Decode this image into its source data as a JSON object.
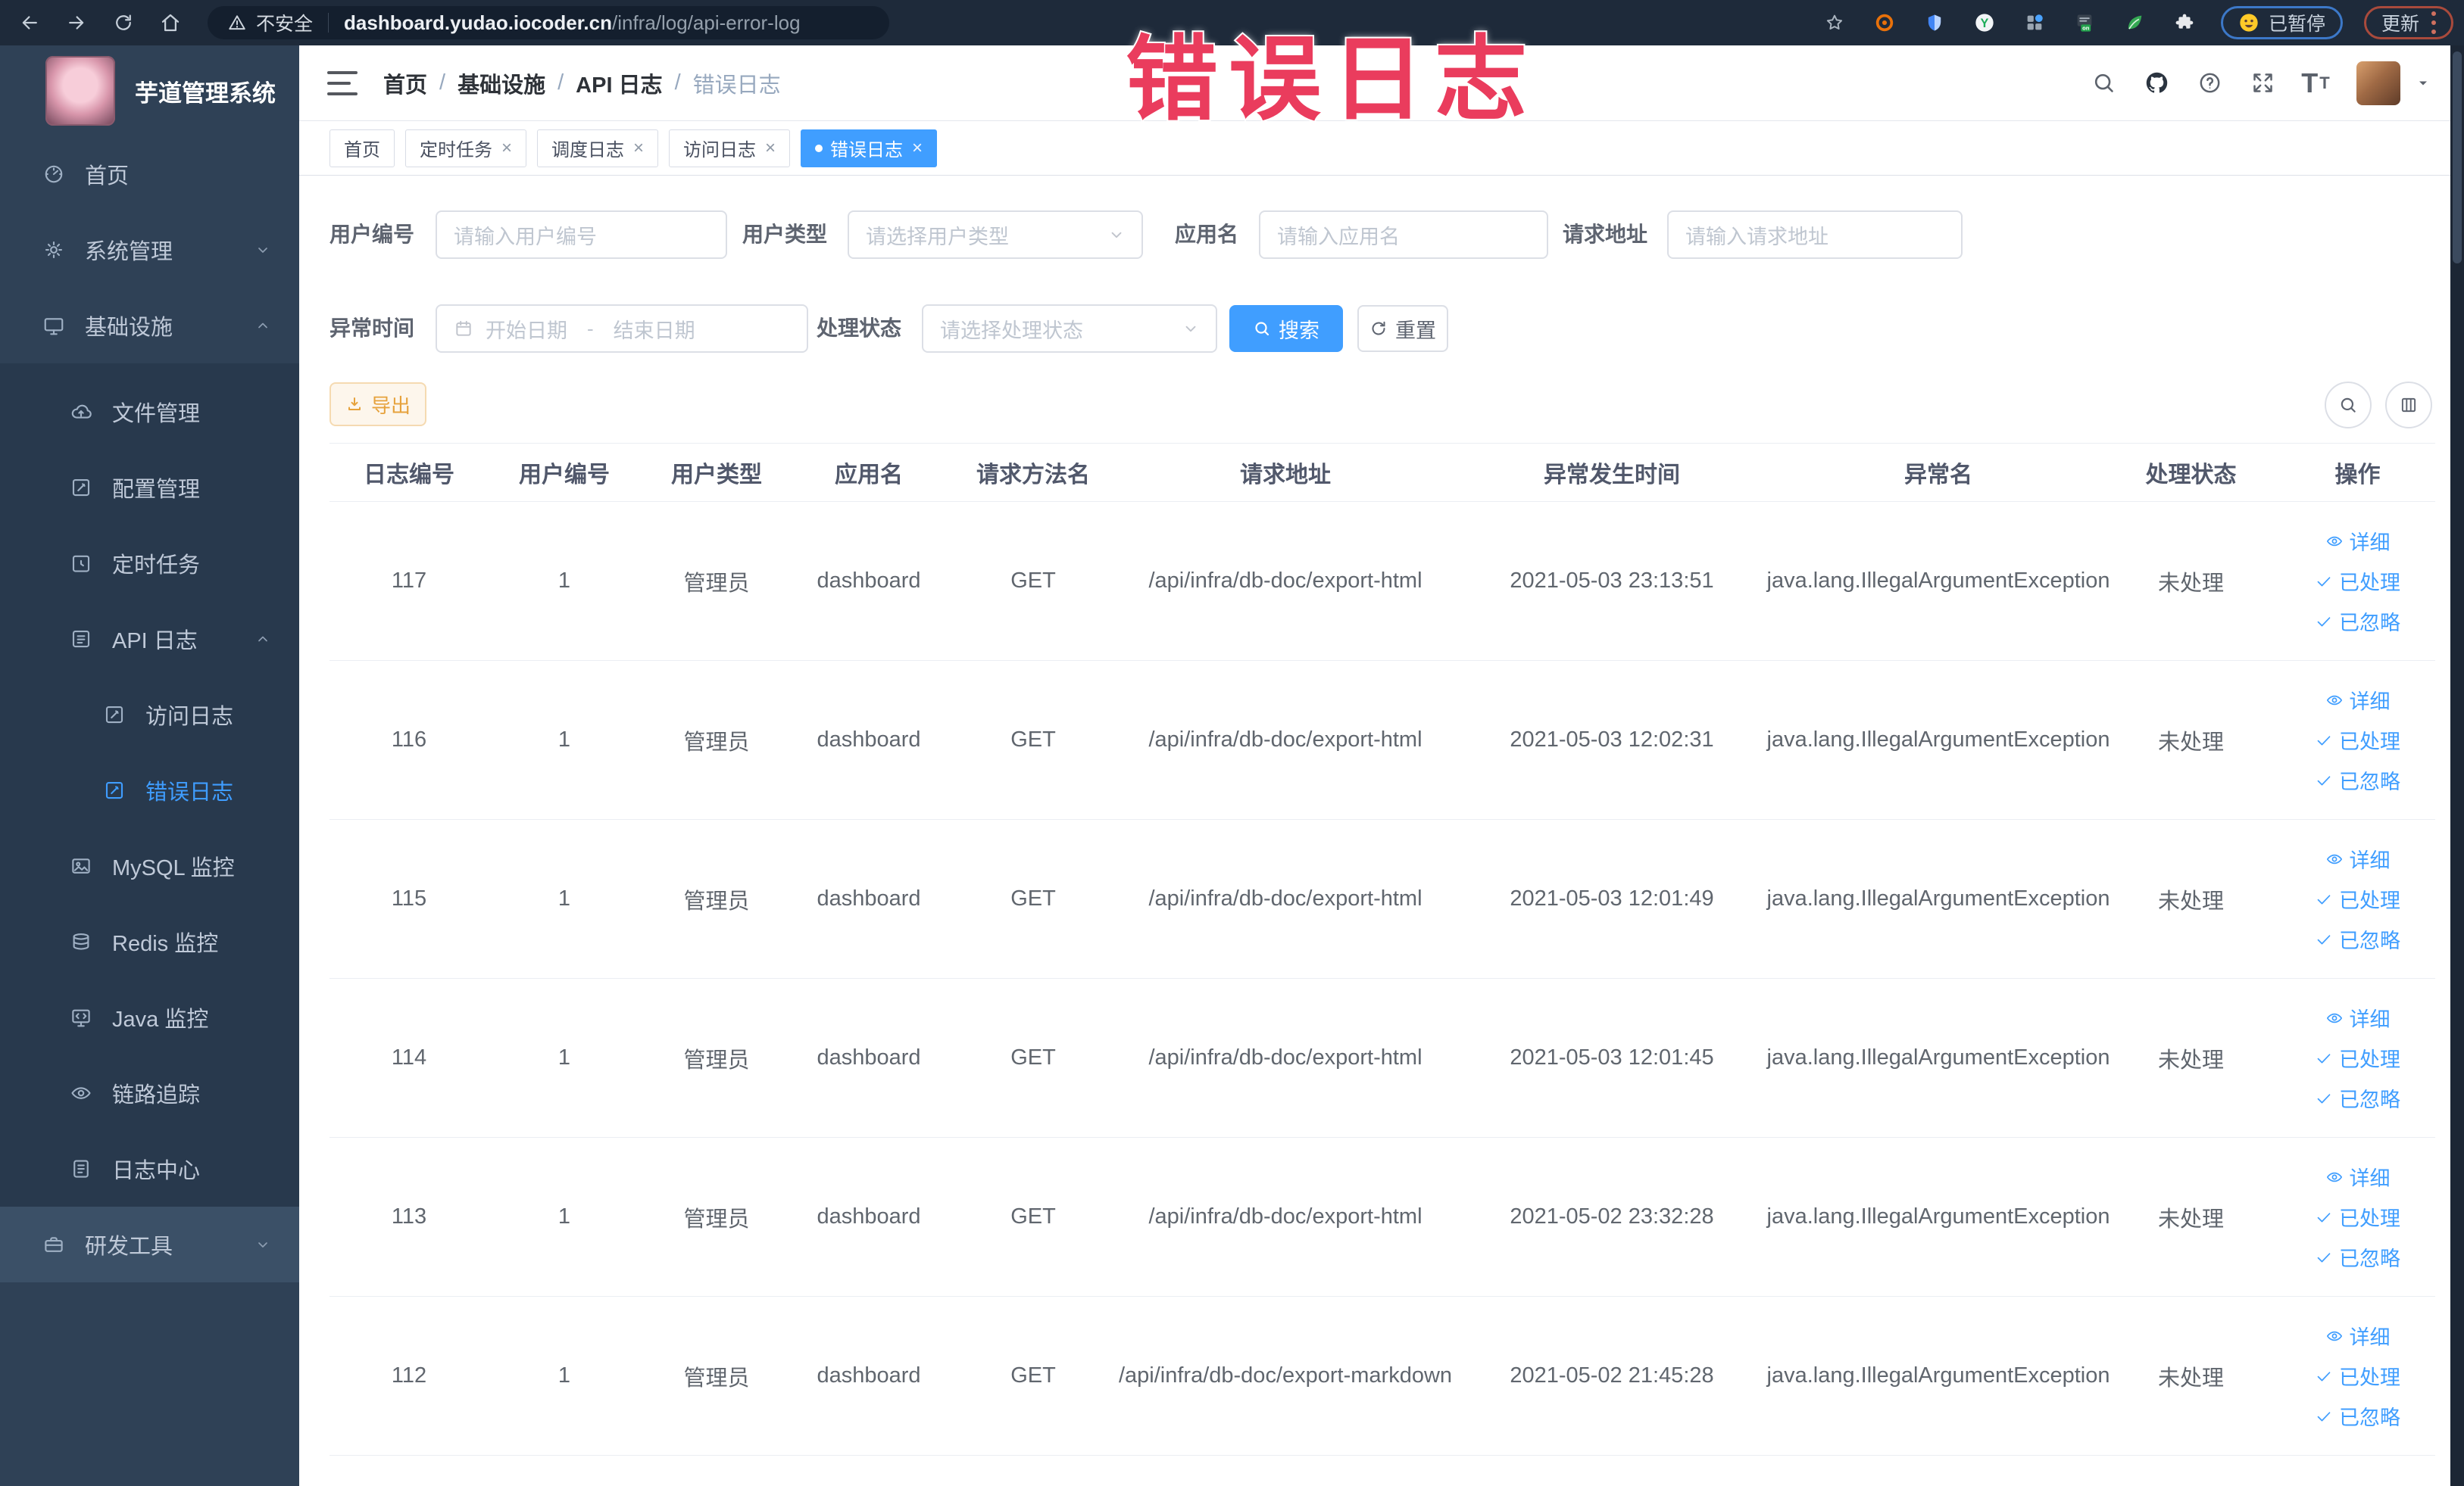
{
  "browser": {
    "security_label": "不安全",
    "url_host": "dashboard.yudao.iocoder.cn",
    "url_path": "/infra/log/api-error-log",
    "ext_badge": "on",
    "paused_label": "已暂停",
    "update_label": "更新"
  },
  "annotation": {
    "text": "错误日志",
    "color": "#ea3c5d"
  },
  "sidebar": {
    "title": "芋道管理系统",
    "items": [
      {
        "label": "首页",
        "icon": "home-icon",
        "level": 1
      },
      {
        "label": "系统管理",
        "icon": "gear-icon",
        "level": 1,
        "chevron": "down"
      },
      {
        "label": "基础设施",
        "icon": "infra-icon",
        "level": 1,
        "chevron": "up"
      },
      {
        "label": "文件管理",
        "icon": "file-icon",
        "level": 2,
        "group": true,
        "pad": true
      },
      {
        "label": "配置管理",
        "icon": "config-icon",
        "level": 2,
        "group": true
      },
      {
        "label": "定时任务",
        "icon": "timer-icon",
        "level": 2,
        "group": true
      },
      {
        "label": "API 日志",
        "icon": "api-log-icon",
        "level": 2,
        "group": true,
        "chevron": "up"
      },
      {
        "label": "访问日志",
        "icon": "doc-icon",
        "level": 3,
        "group": true
      },
      {
        "label": "错误日志",
        "icon": "doc-icon",
        "level": 3,
        "group": true,
        "active": true
      },
      {
        "label": "MySQL 监控",
        "icon": "mysql-icon",
        "level": 2,
        "group": true
      },
      {
        "label": "Redis 监控",
        "icon": "redis-icon",
        "level": 2,
        "group": true
      },
      {
        "label": "Java 监控",
        "icon": "java-icon",
        "level": 2,
        "group": true
      },
      {
        "label": "链路追踪",
        "icon": "trace-icon",
        "level": 2,
        "group": true
      },
      {
        "label": "日志中心",
        "icon": "log-center-icon",
        "level": 2,
        "group": true
      },
      {
        "label": "研发工具",
        "icon": "devtools-icon",
        "level": 1,
        "chevron": "down",
        "highlight": true
      }
    ]
  },
  "breadcrumb": [
    "首页",
    "基础设施",
    "API 日志",
    "错误日志"
  ],
  "tabs": [
    {
      "label": "首页"
    },
    {
      "label": "定时任务",
      "closable": true
    },
    {
      "label": "调度日志",
      "closable": true
    },
    {
      "label": "访问日志",
      "closable": true
    },
    {
      "label": "错误日志",
      "closable": true,
      "active": true
    }
  ],
  "filters": {
    "user_id": {
      "label": "用户编号",
      "placeholder": "请输入用户编号"
    },
    "user_type": {
      "label": "用户类型",
      "placeholder": "请选择用户类型"
    },
    "app_name": {
      "label": "应用名",
      "placeholder": "请输入应用名"
    },
    "request_url": {
      "label": "请求地址",
      "placeholder": "请输入请求地址"
    },
    "exception_time": {
      "label": "异常时间",
      "start_placeholder": "开始日期",
      "separator": "-",
      "end_placeholder": "结束日期"
    },
    "process_status": {
      "label": "处理状态",
      "placeholder": "请选择处理状态"
    },
    "search_label": "搜索",
    "reset_label": "重置"
  },
  "toolbar": {
    "export_label": "导出"
  },
  "table": {
    "columns": [
      "日志编号",
      "用户编号",
      "用户类型",
      "应用名",
      "请求方法名",
      "请求地址",
      "异常发生时间",
      "异常名",
      "处理状态",
      "操作"
    ],
    "action_labels": [
      "详细",
      "已处理",
      "已忽略"
    ],
    "rows": [
      {
        "log_id": "117",
        "user_id": "1",
        "user_type": "管理员",
        "app_name": "dashboard",
        "method": "GET",
        "url": "/api/infra/db-doc/export-html",
        "time": "2021-05-03 23:13:51",
        "exception": "java.lang.IllegalArgumentException",
        "status": "未处理"
      },
      {
        "log_id": "116",
        "user_id": "1",
        "user_type": "管理员",
        "app_name": "dashboard",
        "method": "GET",
        "url": "/api/infra/db-doc/export-html",
        "time": "2021-05-03 12:02:31",
        "exception": "java.lang.IllegalArgumentException",
        "status": "未处理"
      },
      {
        "log_id": "115",
        "user_id": "1",
        "user_type": "管理员",
        "app_name": "dashboard",
        "method": "GET",
        "url": "/api/infra/db-doc/export-html",
        "time": "2021-05-03 12:01:49",
        "exception": "java.lang.IllegalArgumentException",
        "status": "未处理"
      },
      {
        "log_id": "114",
        "user_id": "1",
        "user_type": "管理员",
        "app_name": "dashboard",
        "method": "GET",
        "url": "/api/infra/db-doc/export-html",
        "time": "2021-05-03 12:01:45",
        "exception": "java.lang.IllegalArgumentException",
        "status": "未处理"
      },
      {
        "log_id": "113",
        "user_id": "1",
        "user_type": "管理员",
        "app_name": "dashboard",
        "method": "GET",
        "url": "/api/infra/db-doc/export-html",
        "time": "2021-05-02 23:32:28",
        "exception": "java.lang.IllegalArgumentException",
        "status": "未处理"
      },
      {
        "log_id": "112",
        "user_id": "1",
        "user_type": "管理员",
        "app_name": "dashboard",
        "method": "GET",
        "url": "/api/infra/db-doc/export-markdown",
        "time": "2021-05-02 21:45:28",
        "exception": "java.lang.IllegalArgumentException",
        "status": "未处理"
      }
    ]
  },
  "colors": {
    "accent": "#409eff",
    "warning": "#e6a23c",
    "sidebar_bg": "#2f4156"
  }
}
